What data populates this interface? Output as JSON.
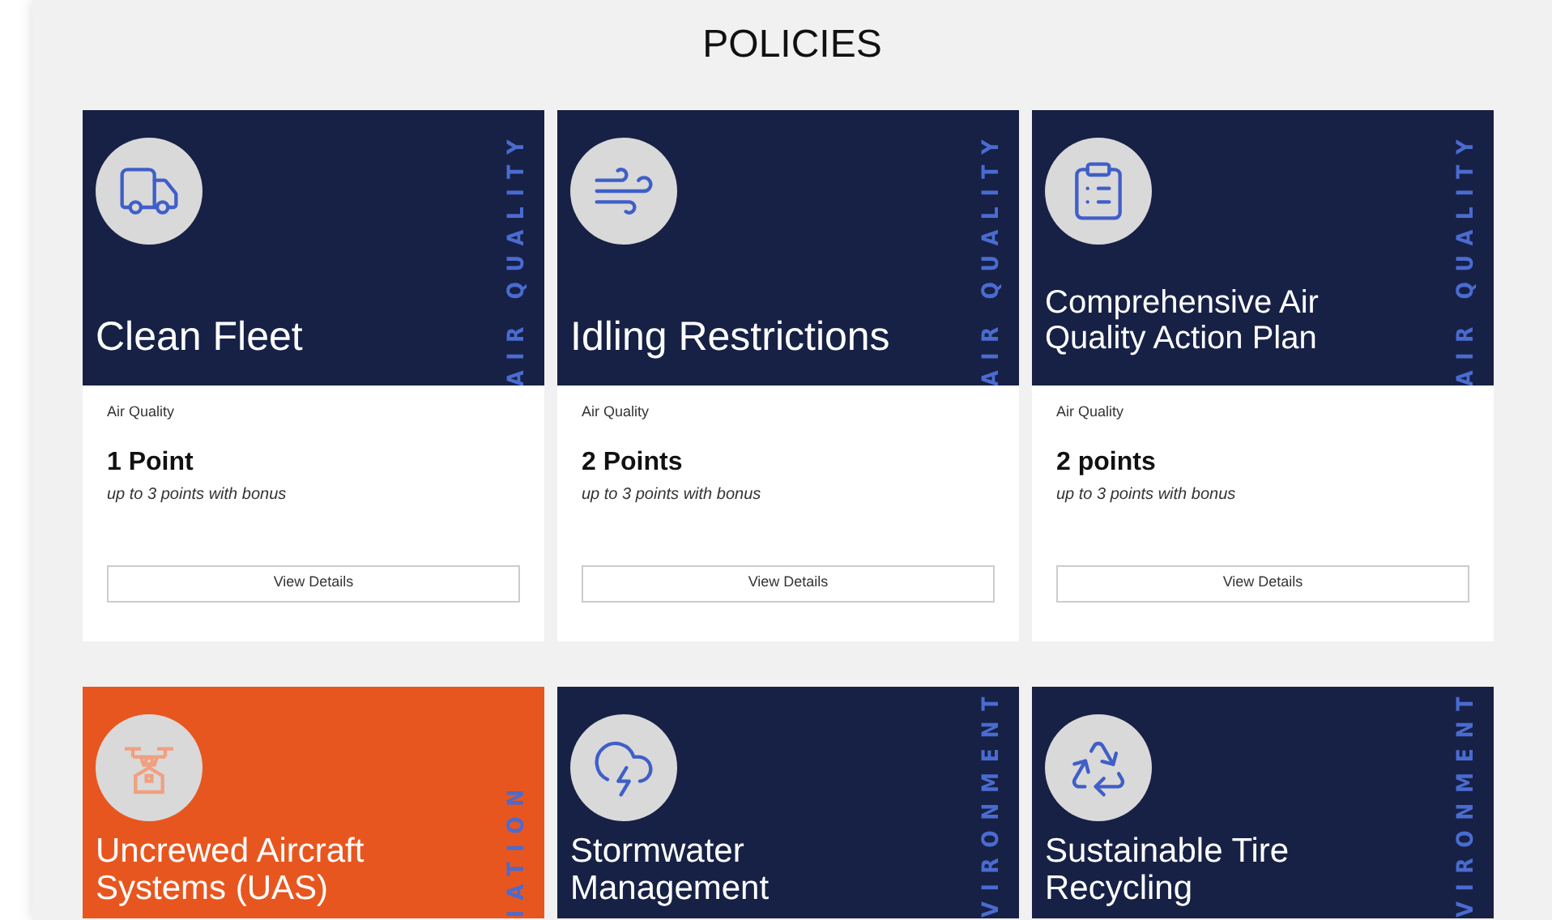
{
  "heading": "POLICIES",
  "cards": [
    {
      "title": "Clean Fleet",
      "side_label": "AIR QUALITY",
      "color": "#172145",
      "category": "Air Quality",
      "points": "1 Point",
      "bonus": "up to 3 points with bonus",
      "button": "View Details"
    },
    {
      "title": "Idling Restrictions",
      "side_label": "AIR QUALITY",
      "color": "#172145",
      "category": "Air Quality",
      "points": "2 Points",
      "bonus": "up to 3 points with bonus",
      "button": "View Details"
    },
    {
      "title": "Comprehensive Air Quality Action Plan",
      "side_label": "AIR QUALITY",
      "color": "#172145",
      "category": "Air Quality",
      "points": "2 points",
      "bonus": "up to 3 points with bonus",
      "button": "View Details"
    },
    {
      "title": "Uncrewed Aircraft Systems (UAS)",
      "side_label": "IATION",
      "color": "#e8561f"
    },
    {
      "title": "Stormwater Management",
      "side_label": "VIRONMENT",
      "color": "#172145"
    },
    {
      "title": "Sustainable Tire Recycling",
      "side_label": "VIRONMENT",
      "color": "#172145"
    }
  ]
}
